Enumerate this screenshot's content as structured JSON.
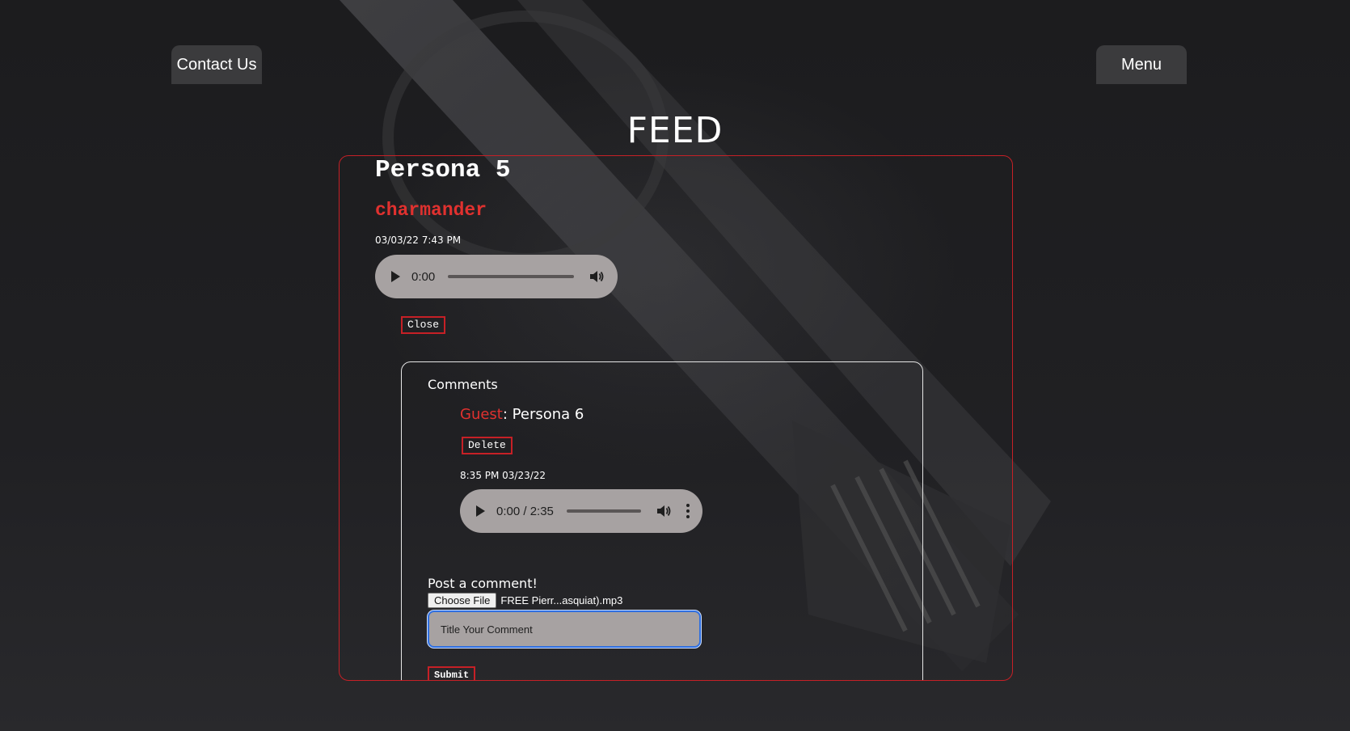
{
  "nav": {
    "contact_label": "Contact Us",
    "menu_label": "Menu"
  },
  "page": {
    "title": "FEED"
  },
  "post": {
    "title": "Persona 5",
    "author": "charmander",
    "date": "03/03/22 7:43 PM",
    "audio": {
      "time": "0:00",
      "progress": 0
    },
    "close_label": "Close"
  },
  "comments": {
    "heading": "Comments",
    "items": [
      {
        "user": "Guest",
        "separator": ": ",
        "title": "Persona 6",
        "delete_label": "Delete",
        "date": "8:35 PM 03/23/22",
        "audio": {
          "time": "0:00 / 2:35",
          "progress": 0
        }
      }
    ]
  },
  "comment_form": {
    "label": "Post a comment!",
    "choose_file_label": "Choose File",
    "file_name": "FREE Pierr...asquiat).mp3",
    "title_placeholder": "Title Your Comment",
    "submit_label": "Submit"
  },
  "colors": {
    "accent": "#c62026",
    "username": "#e0312f",
    "nav_button": "#3b3b3d",
    "audio_player": "#a7a2a2",
    "input_focus": "#2f6fe0"
  },
  "icons": {
    "play": "play-icon",
    "volume": "volume-icon",
    "more": "more-options-icon"
  }
}
